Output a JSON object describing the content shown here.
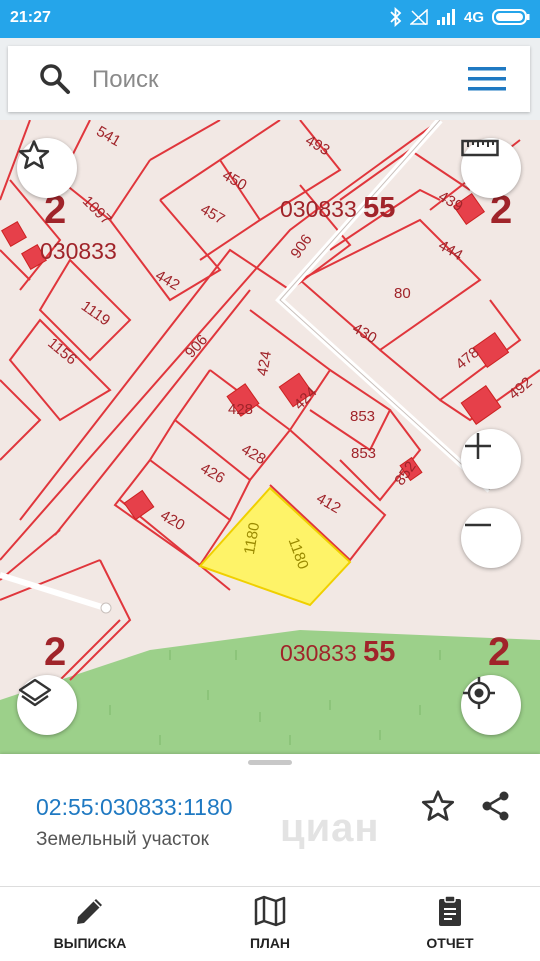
{
  "status_bar": {
    "time": "21:27",
    "network": "4G"
  },
  "search": {
    "placeholder": "Поиск"
  },
  "map": {
    "parcel_labels": [
      "541",
      "493",
      "450",
      "1097",
      "457",
      "906",
      "439",
      "444",
      "442",
      "1119",
      "80",
      "430",
      "1156",
      "906",
      "478",
      "492",
      "424",
      "424",
      "428",
      "428",
      "853",
      "853",
      "426",
      "852",
      "412",
      "420",
      "1180",
      "1180"
    ],
    "quarter_labels": [
      {
        "prefix": "030833",
        "suffix": "55"
      },
      {
        "prefix": "030833",
        "suffix": ""
      },
      {
        "prefix": "030833",
        "suffix": "55"
      }
    ],
    "district_labels": [
      "2",
      "2",
      "2",
      "2"
    ],
    "selected_color": "#fff45a",
    "boundary_color": "#e0363c"
  },
  "info_panel": {
    "cadastral_number": "02:55:030833:1180",
    "object_type": "Земельный участок",
    "watermark": "циан"
  },
  "bottom_nav": [
    {
      "label": "ВЫПИСКА",
      "icon": "pencil-icon"
    },
    {
      "label": "ПЛАН",
      "icon": "map-icon"
    },
    {
      "label": "ОТЧЕТ",
      "icon": "clipboard-icon"
    }
  ]
}
